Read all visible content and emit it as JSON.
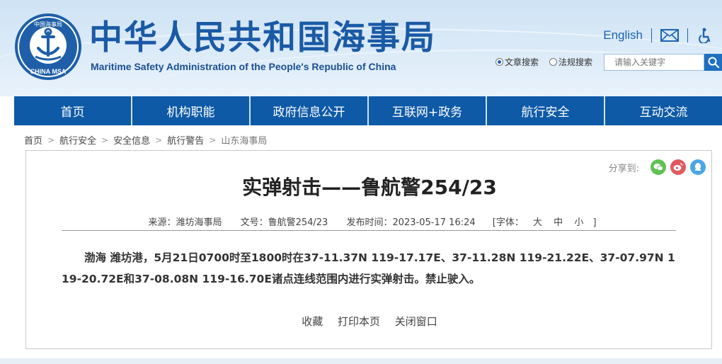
{
  "header": {
    "title": "中华人民共和国海事局",
    "subtitle": "Maritime Safety Administration of the People's Republic of China",
    "logo": {
      "top_text": "中国海事局",
      "bottom_text": "CHINA MSA",
      "icon": "anchor-icon"
    },
    "english_link": "English",
    "mail_icon": "mail-icon",
    "accessibility_icon": "accessibility-icon"
  },
  "search": {
    "option_article": "文章搜索",
    "option_regulation": "法规搜索",
    "selected": "文章搜索",
    "placeholder": "请输入关键字",
    "button_icon": "search-icon"
  },
  "nav": {
    "items": [
      {
        "label": "首页"
      },
      {
        "label": "机构职能"
      },
      {
        "label": "政府信息公开"
      },
      {
        "label": "互联网+政务"
      },
      {
        "label": "航行安全"
      },
      {
        "label": "互动交流"
      }
    ]
  },
  "breadcrumb": {
    "items": [
      "首页",
      "航行安全",
      "安全信息",
      "航行警告",
      "山东海事局"
    ]
  },
  "article": {
    "share_label": "分享到:",
    "title": "实弹射击——鲁航警254/23",
    "source": "来源：潍坊海事局",
    "doc_no": "文号：鲁航警254/23",
    "publish_time": "发布时间：2023-05-17 16:24",
    "font_label": "[字体：",
    "font_large": "大",
    "font_medium": "中",
    "font_small": "小",
    "font_close": "]",
    "body": "渤海 潍坊港，5月21日0700时至1800时在37-11.37N 119-17.17E、37-11.28N 119-21.22E、37-07.97N 119-20.72E和37-08.08N 119-16.70E诸点连线范围内进行实弹射击。禁止驶入。",
    "action_favorite": "收藏",
    "action_print": "打印本页",
    "action_close": "关闭窗口"
  },
  "colors": {
    "brand_blue": "#1a5aa6",
    "nav_blue": "#0e5aa7",
    "header_bg": "#d6e8f7"
  }
}
